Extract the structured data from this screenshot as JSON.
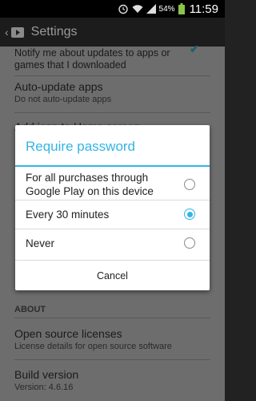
{
  "status_bar": {
    "battery_text": "54%",
    "clock": "11:59",
    "icons": [
      "alarm-icon",
      "wifi-icon",
      "signal-icon",
      "battery-icon"
    ]
  },
  "action_bar": {
    "title": "Settings",
    "app_icon": "play-store-icon"
  },
  "background_prefs": {
    "notify": {
      "secondary": "Notify me about updates to apps or games that I downloaded",
      "checked": true
    },
    "auto_update": {
      "primary": "Auto-update apps",
      "secondary": "Do not auto-update apps"
    },
    "add_icon": {
      "primary": "Add icon to Home screen"
    }
  },
  "about": {
    "header": "ABOUT",
    "licenses": {
      "primary": "Open source licenses",
      "secondary": "License details for open source software"
    },
    "build": {
      "primary": "Build version",
      "secondary": "Version: 4.6.16"
    }
  },
  "dialog": {
    "title": "Require password",
    "options": [
      {
        "label": "For all purchases through Google Play on this device",
        "checked": false
      },
      {
        "label": "Every 30 minutes",
        "checked": true
      },
      {
        "label": "Never",
        "checked": false
      }
    ],
    "cancel_label": "Cancel"
  },
  "colors": {
    "accent": "#33b5e5",
    "dim_background": "#6d6d6d",
    "status_bar": "#000000"
  }
}
